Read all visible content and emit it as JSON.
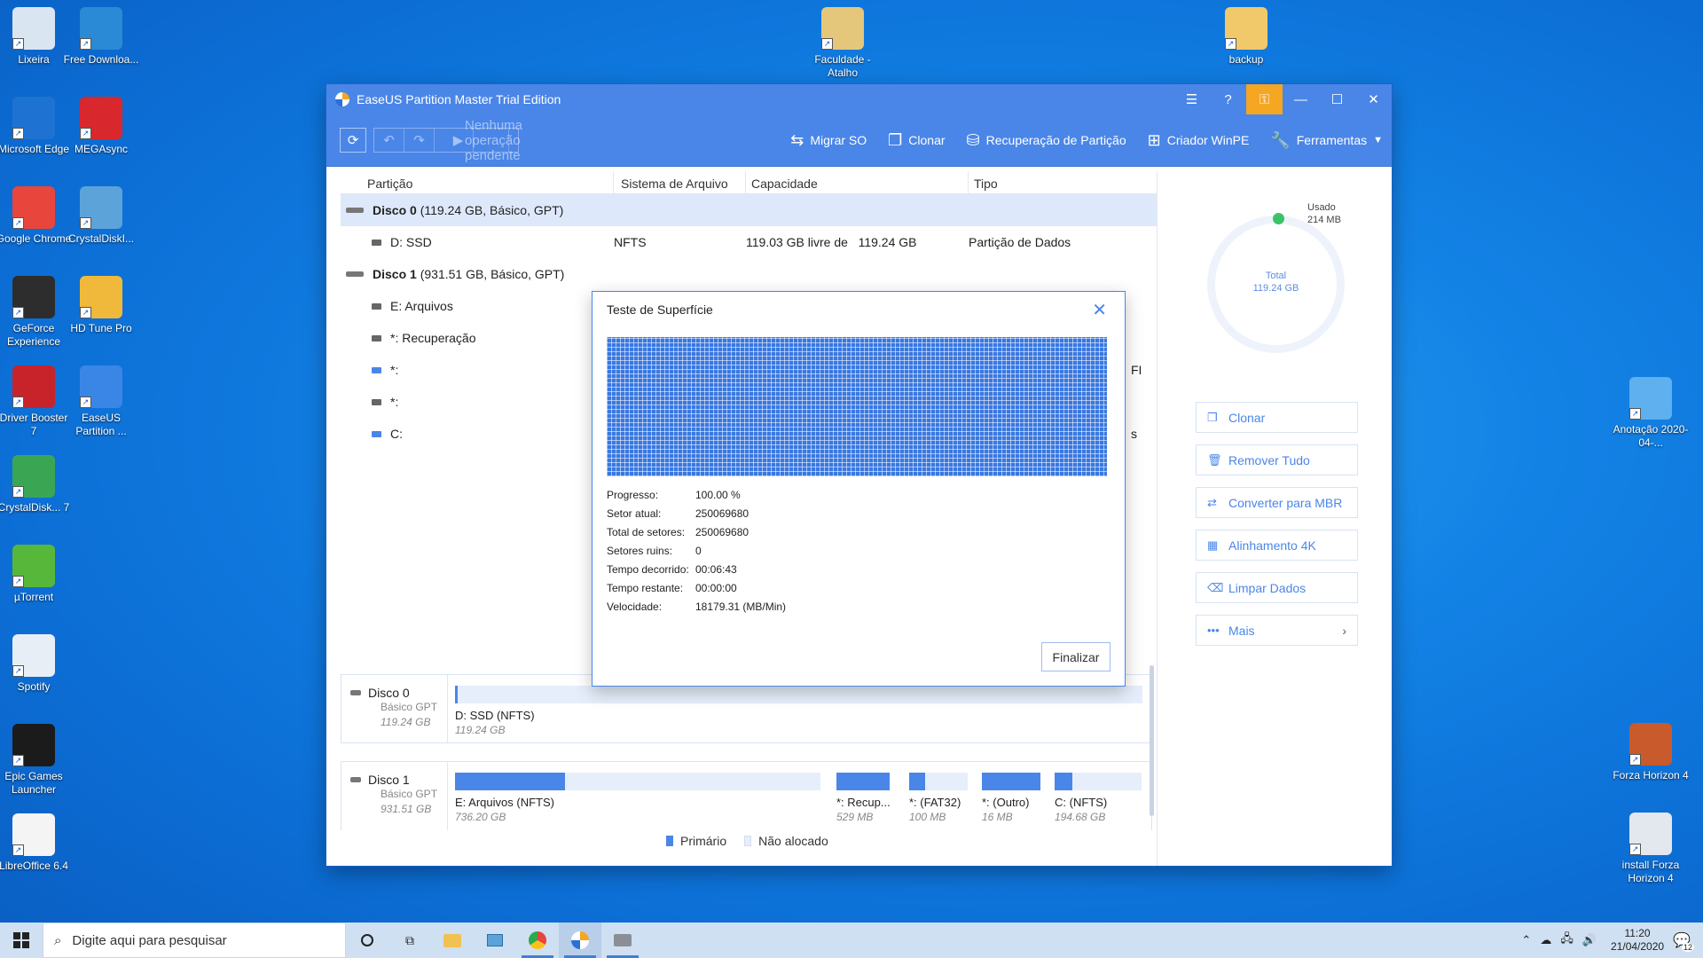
{
  "desktop": {
    "icons_left": [
      {
        "label": "Lixeira",
        "icon": "recycle-bin-icon",
        "color": "#d9e6f2"
      },
      {
        "label": "Free Downloa...",
        "icon": "free-download-manager-icon",
        "color": "#2a8ad6"
      },
      {
        "label": "Microsoft Edge",
        "icon": "edge-icon",
        "color": "#1e73d2"
      },
      {
        "label": "MEGAsync",
        "icon": "mega-icon",
        "color": "#d9272e"
      },
      {
        "label": "Google Chrome",
        "icon": "chrome-icon",
        "color": "#e8453c"
      },
      {
        "label": "CrystalDiskI...",
        "icon": "crystaldiskinfo-icon",
        "color": "#5ba3d9"
      },
      {
        "label": "GeForce Experience",
        "icon": "geforce-icon",
        "color": "#2d2d2d"
      },
      {
        "label": "HD Tune Pro",
        "icon": "hdtune-icon",
        "color": "#f0b93b"
      },
      {
        "label": "Driver Booster 7",
        "icon": "driver-booster-icon",
        "color": "#c8232b"
      },
      {
        "label": "EaseUS Partition ...",
        "icon": "easeus-icon",
        "color": "#3a86e6"
      },
      {
        "label": "CrystalDisk... 7",
        "icon": "crystaldiskmark-icon",
        "color": "#3aa654"
      },
      {
        "label": "µTorrent",
        "icon": "utorrent-icon",
        "color": "#57b73b"
      },
      {
        "label": "Spotify",
        "icon": "spotify-shortcut-icon",
        "color": "#e8eef6"
      },
      {
        "label": "Epic Games Launcher",
        "icon": "epic-games-icon",
        "color": "#1b1b1b"
      },
      {
        "label": "LibreOffice 6.4",
        "icon": "libreoffice-icon",
        "color": "#f4f4f4"
      }
    ],
    "icons_top": [
      {
        "label": "Faculdade - Atalho",
        "icon": "pdf-shortcut-icon",
        "color": "#e5c77b"
      },
      {
        "label": "backup",
        "icon": "folder-icon",
        "color": "#f1c96b"
      }
    ],
    "icons_right": [
      {
        "label": "Anotação 2020-04-...",
        "icon": "image-file-icon",
        "color": "#5fb0ee"
      },
      {
        "label": "Forza Horizon 4",
        "icon": "forza-icon",
        "color": "#c95a2b"
      },
      {
        "label": "install Forza Horizon 4",
        "icon": "installer-icon",
        "color": "#e3e7ee"
      }
    ]
  },
  "window": {
    "title": "EaseUS Partition Master Trial Edition",
    "accent": "#4a86e8",
    "toolbar": {
      "pending": "Nenhuma operação pendente",
      "actions": [
        {
          "label": "Migrar SO",
          "icon": "migrate-icon"
        },
        {
          "label": "Clonar",
          "icon": "clone-icon"
        },
        {
          "label": "Recuperação de Partição",
          "icon": "partition-recovery-icon"
        },
        {
          "label": "Criador WinPE",
          "icon": "winpe-icon"
        },
        {
          "label": "Ferramentas",
          "icon": "tools-icon"
        }
      ]
    },
    "table": {
      "columns": [
        "Partição",
        "Sistema de Arquivo",
        "Capacidade",
        "Tipo"
      ],
      "disk0": {
        "name": "Disco 0",
        "info": "(119.24 GB, Básico, GPT)"
      },
      "disk0_partition": {
        "name": "D: SSD",
        "fs": "NFTS",
        "free": "119.03 GB livre de",
        "total": "119.24 GB",
        "type": "Partição de Dados"
      },
      "disk1": {
        "name": "Disco 1",
        "info": "(931.51 GB, Básico, GPT)"
      },
      "disk1_partitions": [
        "E: Arquivos",
        "*: Recuperação",
        "*:",
        "*:",
        "C:"
      ],
      "cut_off_fragments": [
        "FI",
        "s"
      ]
    },
    "right_panel": {
      "used_label": "Usado",
      "used_value": "214 MB",
      "total_label": "Total",
      "total_value": "119.24 GB",
      "buttons": [
        {
          "label": "Clonar",
          "icon": "clone-icon"
        },
        {
          "label": "Remover Tudo",
          "icon": "trash-icon"
        },
        {
          "label": "Converter para MBR",
          "icon": "convert-icon"
        },
        {
          "label": "Alinhamento 4K",
          "icon": "align-4k-icon"
        },
        {
          "label": "Limpar Dados",
          "icon": "eraser-icon"
        },
        {
          "label": "Mais",
          "icon": "more-icon"
        }
      ]
    },
    "disk_map": {
      "disk0": {
        "name": "Disco 0",
        "type": "Básico GPT",
        "size": "119.24 GB",
        "segments": [
          {
            "label": "D: SSD (NFTS)",
            "size": "119.24 GB",
            "used": 0.002
          }
        ]
      },
      "disk1": {
        "name": "Disco 1",
        "type": "Básico GPT",
        "size": "931.51 GB",
        "segments": [
          {
            "label": "E: Arquivos (NFTS)",
            "size": "736.20 GB",
            "used": 0.3
          },
          {
            "label": "*: Recup...",
            "size": "529 MB",
            "used": 1.0
          },
          {
            "label": "*: (FAT32)",
            "size": "100 MB",
            "used": 0.28
          },
          {
            "label": "*: (Outro)",
            "size": "16 MB",
            "used": 1.0
          },
          {
            "label": "C: (NFTS)",
            "size": "194.68 GB",
            "used": 0.2
          }
        ]
      }
    },
    "legend": {
      "primary": "Primário",
      "unallocated": "Não alocado"
    }
  },
  "dialog": {
    "title": "Teste de Superfície",
    "stats": [
      {
        "key": "Progresso:",
        "value": "100.00 %"
      },
      {
        "key": "Setor atual:",
        "value": "250069680"
      },
      {
        "key": "Total de setores:",
        "value": "250069680"
      },
      {
        "key": "Setores ruins:",
        "value": "0"
      },
      {
        "key": "Tempo decorrido:",
        "value": "00:06:43"
      },
      {
        "key": "Tempo restante:",
        "value": "00:00:00"
      },
      {
        "key": "Velocidade:",
        "value": "18179.31 (MB/Min)"
      }
    ],
    "finish": "Finalizar"
  },
  "taskbar": {
    "search_placeholder": "Digite aqui para pesquisar",
    "time": "11:20",
    "date": "21/04/2020",
    "notifications": "12"
  }
}
